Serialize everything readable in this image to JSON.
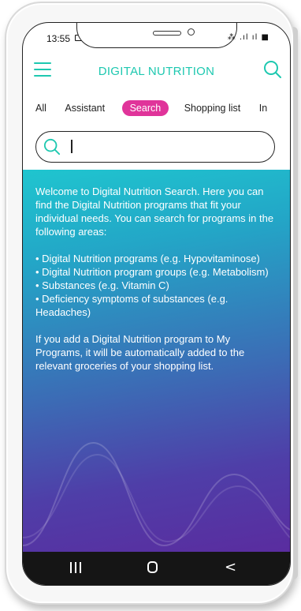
{
  "status_bar": {
    "time": "13:55",
    "right_icons": "⁂ .ıl ıl ■"
  },
  "header": {
    "title": "DIGITAL NUTRITION",
    "menu_icon": "hamburger-menu-icon",
    "search_icon": "search-icon"
  },
  "tabs": [
    {
      "label": "All",
      "active": false
    },
    {
      "label": "Assistant",
      "active": false
    },
    {
      "label": "Search",
      "active": true
    },
    {
      "label": "Shopping list",
      "active": false
    },
    {
      "label": "In",
      "active": false
    }
  ],
  "search": {
    "value": "",
    "placeholder": ""
  },
  "content": {
    "intro": "Welcome to Digital Nutrition Search. Here you can find the Digital Nutrition programs that fit your individual needs. You can search for programs in the following areas:",
    "bullets": [
      "• Digital Nutrition programs (e.g. Hypovitaminose)",
      "• Digital Nutrition program groups (e.g. Metabolism)",
      "• Substances (e.g. Vitamin C)",
      "• Deficiency symptoms of substances (e.g. Headaches)"
    ],
    "outro": "If you add a Digital Nutrition program to My Programs, it will be automatically added to the relevant groceries of your shopping list."
  },
  "nav_bar": {
    "recents_icon": "recents-icon",
    "home_icon": "home-icon",
    "back_icon": "back-icon",
    "back_glyph": "<"
  },
  "colors": {
    "accent": "#1ec8b0",
    "active_tab": "#e0349a",
    "gradient_top": "#1fc5cf",
    "gradient_bottom": "#5a2c9f",
    "nav_bg": "#151515"
  }
}
